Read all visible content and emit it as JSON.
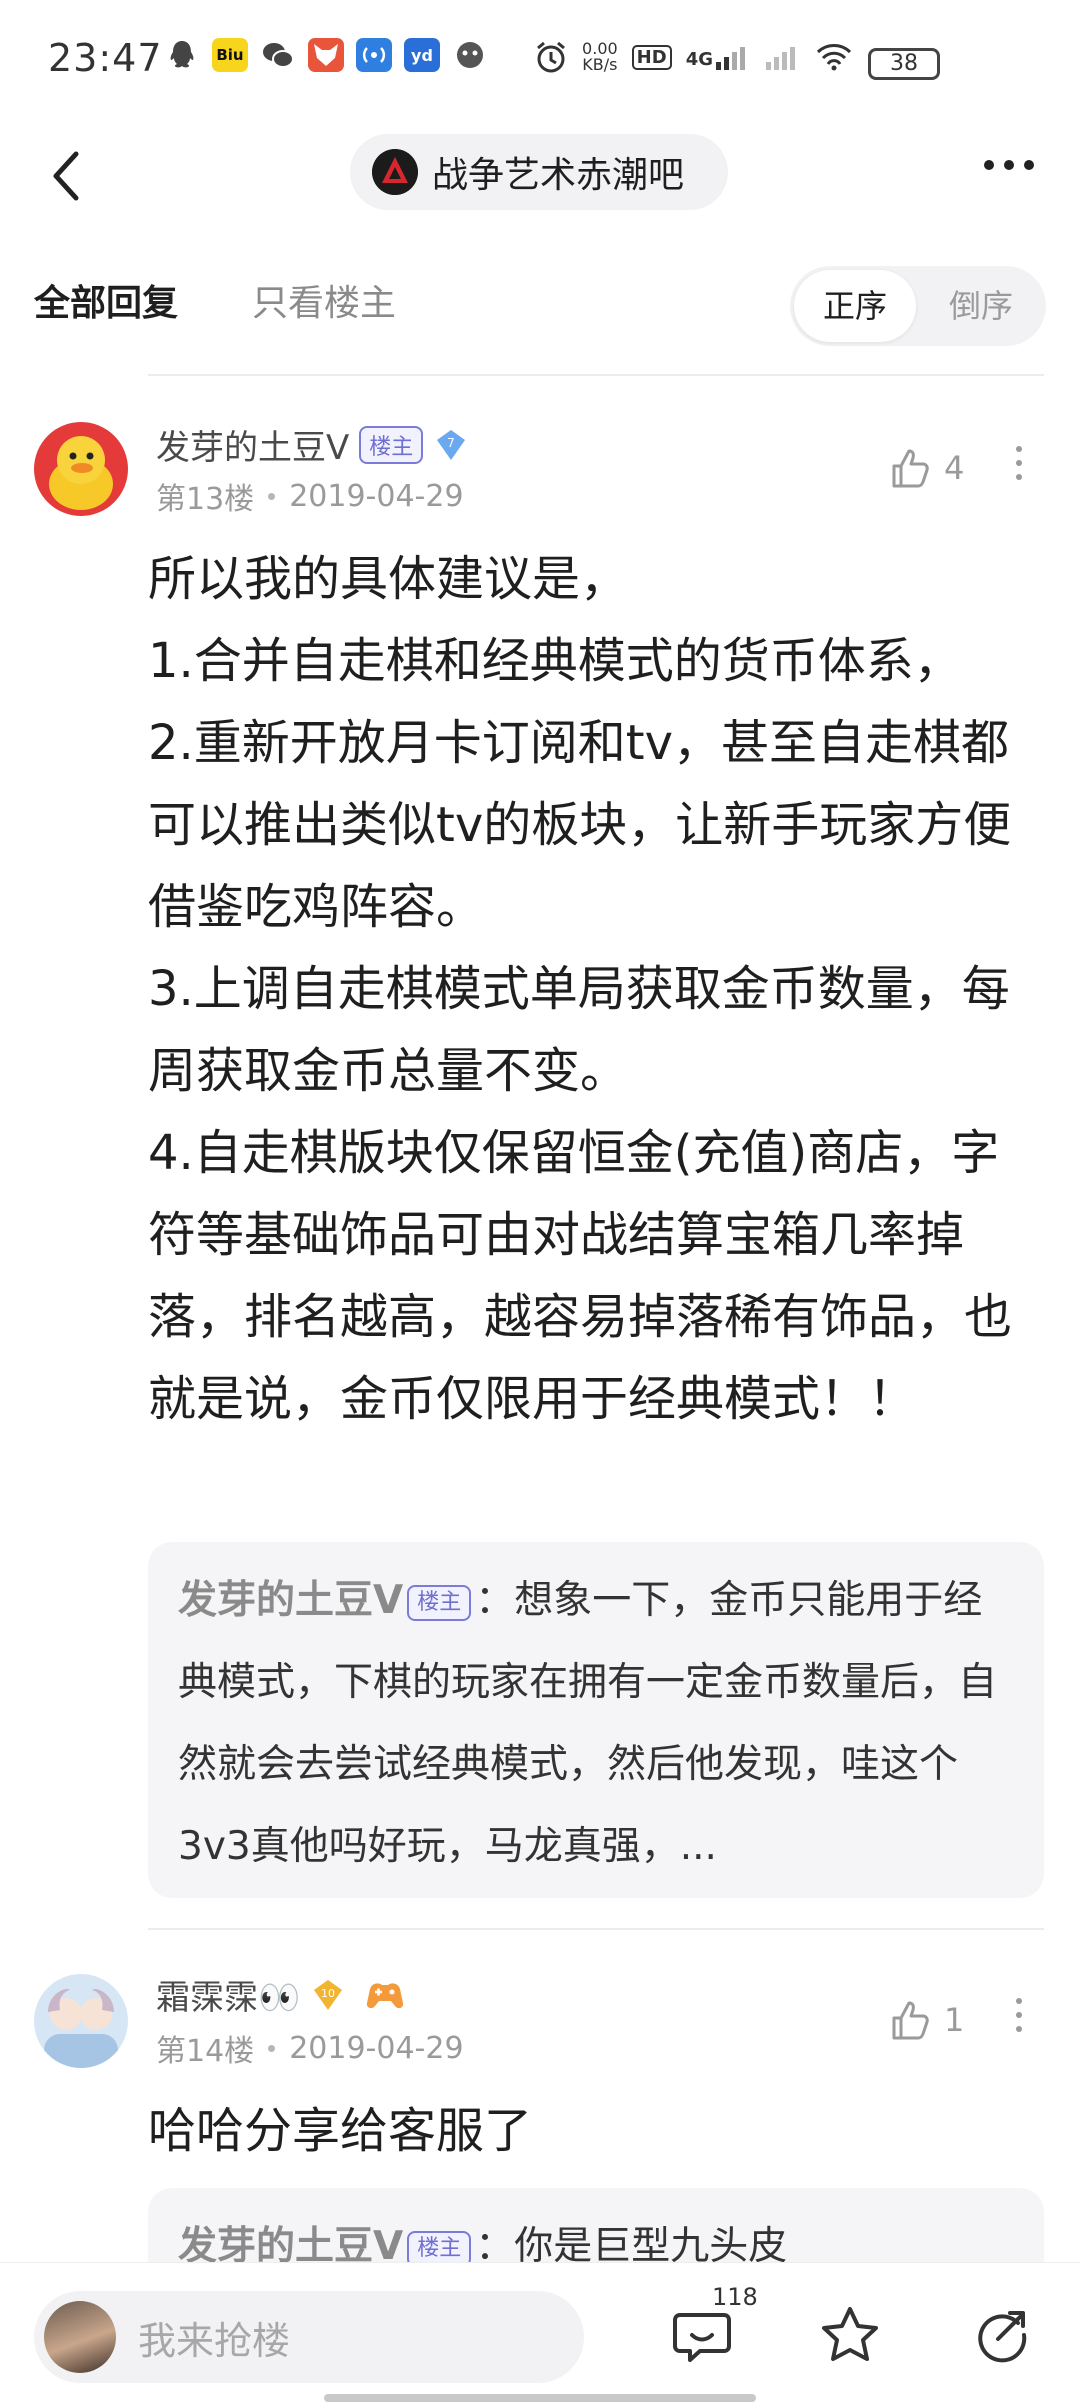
{
  "status_bar": {
    "time": "23:47",
    "net_speed_value": "0.00",
    "net_speed_unit": "KB/s",
    "hd_label": "HD",
    "signal_label": "4G",
    "battery": "38"
  },
  "nav": {
    "forum_name": "战争艺术赤潮吧"
  },
  "tabs": {
    "all_replies": "全部回复",
    "op_only": "只看楼主",
    "sort_asc": "正序",
    "sort_desc": "倒序"
  },
  "posts": [
    {
      "author": "发芽的土豆V",
      "op_badge": "楼主",
      "level": "7",
      "floor": "第13楼",
      "date": "2019-04-29",
      "likes": "4",
      "body": "所以我的具体建议是，\n1.合并自走棋和经典模式的货币体系，\n2.重新开放月卡订阅和tv，甚至自走棋都可以推出类似tv的板块，让新手玩家方便借鉴吃鸡阵容。\n3.上调自走棋模式单局获取金币数量，每周获取金币总量不变。\n4.自走棋版块仅保留恒金(充值)商店，字符等基础饰品可由对战结算宝箱几率掉落，排名越高，越容易掉落稀有饰品，也就是说，金币仅限用于经典模式！！",
      "reply": {
        "author": "发芽的土豆V",
        "badge": "楼主",
        "text": "：想象一下，金币只能用于经典模式，下棋的玩家在拥有一定金币数量后，自然就会去尝试经典模式，然后他发现，哇这个3v3真他吗好玩，马龙真强，..."
      }
    },
    {
      "author": "霜霂霂👀",
      "level": "10",
      "floor": "第14楼",
      "date": "2019-04-29",
      "likes": "1",
      "body": "哈哈分享给客服了",
      "reply": {
        "author": "发芽的土豆V",
        "badge": "楼主",
        "text": "：你是巨型九头皮"
      }
    }
  ],
  "bottom_bar": {
    "placeholder": "我来抢楼",
    "comment_count": "118"
  },
  "colors": {
    "accent_badge": "#6f6fd0",
    "level_badge_blue": "#6aa8f0",
    "level_badge_gold": "#f2b431"
  }
}
